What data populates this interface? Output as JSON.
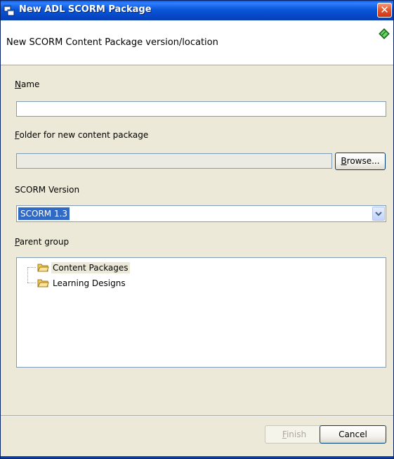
{
  "window": {
    "title": "New ADL SCORM Package",
    "close_glyph": "✕"
  },
  "banner": {
    "title": "New SCORM Content Package version/location",
    "icon": "green-book-icon"
  },
  "form": {
    "name": {
      "label_mnemonic": "N",
      "label_rest": "ame",
      "value": ""
    },
    "folder": {
      "label_mnemonic": "F",
      "label_rest": "older for new content package",
      "value": "",
      "browse_mnemonic": "B",
      "browse_rest": "rowse..."
    },
    "scorm_version": {
      "label": "SCORM Version",
      "selected": "SCORM 1.3"
    },
    "parent_group": {
      "label_mnemonic": "P",
      "label_rest": "arent group",
      "items": [
        {
          "label": "Content Packages",
          "icon": "folder-icon",
          "selected": true
        },
        {
          "label": "Learning Designs",
          "icon": "folder-icon",
          "selected": false
        }
      ]
    }
  },
  "footer": {
    "finish_mnemonic": "F",
    "finish_rest": "inish",
    "finish_enabled": false,
    "cancel_label": "Cancel"
  },
  "colors": {
    "titlebar": "#0a56d8",
    "dialog_bg": "#ece9d8",
    "selection": "#316ac5",
    "field_border": "#7f9db9",
    "close_button": "#e35a2d"
  }
}
